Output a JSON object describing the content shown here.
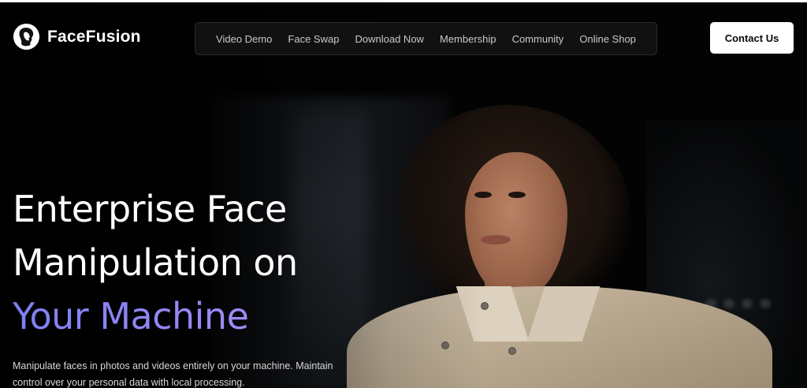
{
  "brand": {
    "name": "FaceFusion",
    "logo_icon": "face-profile-icon"
  },
  "nav": {
    "items": [
      {
        "label": "Video Demo"
      },
      {
        "label": "Face Swap"
      },
      {
        "label": "Download Now"
      },
      {
        "label": "Membership"
      },
      {
        "label": "Community"
      },
      {
        "label": "Online Shop"
      }
    ]
  },
  "header": {
    "contact_label": "Contact Us"
  },
  "hero": {
    "title_line1": "Enterprise Face",
    "title_line2": "Manipulation on",
    "title_accent": "Your Machine",
    "description": "Manipulate faces in photos and videos entirely on your machine. Maintain control over your personal data with local processing."
  },
  "colors": {
    "background": "#030303",
    "accent_start": "#7c7ff2",
    "accent_end": "#b69af7",
    "button_bg": "#ffffff",
    "text": "#ffffff"
  }
}
